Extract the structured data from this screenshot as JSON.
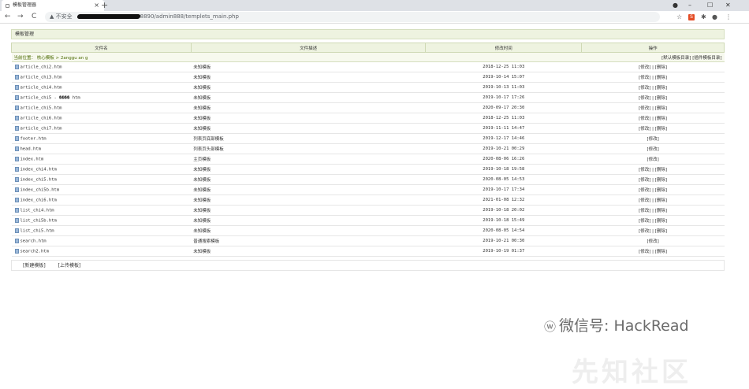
{
  "browser": {
    "tab_title": "模板管理器",
    "tab_close": "×",
    "new_tab": "+",
    "win_profile": "●",
    "win_min": "–",
    "win_max": "☐",
    "win_close": "✕",
    "back": "←",
    "forward": "→",
    "reload": "C",
    "security_label": "▲ 不安全",
    "url": "8890/admin888/templets_main.php",
    "star": "☆",
    "ext1": "S",
    "ext2": "✱",
    "profile": "●",
    "menu": "⋮"
  },
  "panel": {
    "title": "模板管理",
    "columns": [
      "文件名",
      "文件描述",
      "修改时间",
      "操作"
    ],
    "location_prefix": "当前位置： 核心模板 > 2anggu an g",
    "location_links": "[默认模板目录] [插件模板目录]",
    "rows": [
      {
        "name": "article_chi2.htm",
        "desc": "未知模板",
        "time": "2018-12-25 11:03",
        "ops": "[修改] | [删除]"
      },
      {
        "name": "article_chi3.htm",
        "desc": "未知模板",
        "time": "2019-10-14 15:07",
        "ops": "[修改] | [删除]"
      },
      {
        "name": "article_chi4.htm",
        "desc": "未知模板",
        "time": "2019-10-13 11:03",
        "ops": "[修改] | [删除]"
      },
      {
        "name": "article_chi5 - ���� htm",
        "desc": "未知模板",
        "time": "2019-10-17 17:26",
        "ops": "[修改] | [删除]"
      },
      {
        "name": "article_chi5.htm",
        "desc": "未知模板",
        "time": "2020-09-17 20:30",
        "ops": "[修改] | [删除]"
      },
      {
        "name": "article_chi6.htm",
        "desc": "未知模板",
        "time": "2018-12-25 11:03",
        "ops": "[修改] | [删除]"
      },
      {
        "name": "article_chi7.htm",
        "desc": "未知模板",
        "time": "2019-11-11 14:47",
        "ops": "[修改] | [删除]"
      },
      {
        "name": "footer.htm",
        "desc": "列表页底部模板",
        "time": "2019-12-17 14:46",
        "ops": "[修改]"
      },
      {
        "name": "head.htm",
        "desc": "列表页头部模板",
        "time": "2019-10-21 00:29",
        "ops": "[修改]"
      },
      {
        "name": "index.htm",
        "desc": "主页模板",
        "time": "2020-08-06 16:26",
        "ops": "[修改]"
      },
      {
        "name": "index_chi4.htm",
        "desc": "未知模板",
        "time": "2019-10-18 19:58",
        "ops": "[修改] | [删除]"
      },
      {
        "name": "index_chi5.htm",
        "desc": "未知模板",
        "time": "2020-08-05 14:53",
        "ops": "[修改] | [删除]"
      },
      {
        "name": "index_chi5b.htm",
        "desc": "未知模板",
        "time": "2019-10-17 17:34",
        "ops": "[修改] | [删除]"
      },
      {
        "name": "index_chi6.htm",
        "desc": "未知模板",
        "time": "2021-01-08 12:32",
        "ops": "[修改] | [删除]"
      },
      {
        "name": "list_chi4.htm",
        "desc": "未知模板",
        "time": "2019-10-18 20:02",
        "ops": "[修改] | [删除]"
      },
      {
        "name": "list_chi5b.htm",
        "desc": "未知模板",
        "time": "2019-10-18 15:49",
        "ops": "[修改] | [删除]"
      },
      {
        "name": "list_chi5.htm",
        "desc": "未知模板",
        "time": "2020-08-05 14:54",
        "ops": "[修改] | [删除]"
      },
      {
        "name": "search.htm",
        "desc": "普通搜索模板",
        "time": "2019-10-21 00:30",
        "ops": "[修改]"
      },
      {
        "name": "search2.htm",
        "desc": "未知模板",
        "time": "2019-10-19 01:37",
        "ops": "[修改] | [删除]"
      }
    ],
    "footer_new": "[新建模板]",
    "footer_upload": "[上传模板]"
  },
  "watermark": {
    "icon": "ⓦ",
    "text": "微信号: HackRead",
    "bg_text": "先知社区"
  }
}
